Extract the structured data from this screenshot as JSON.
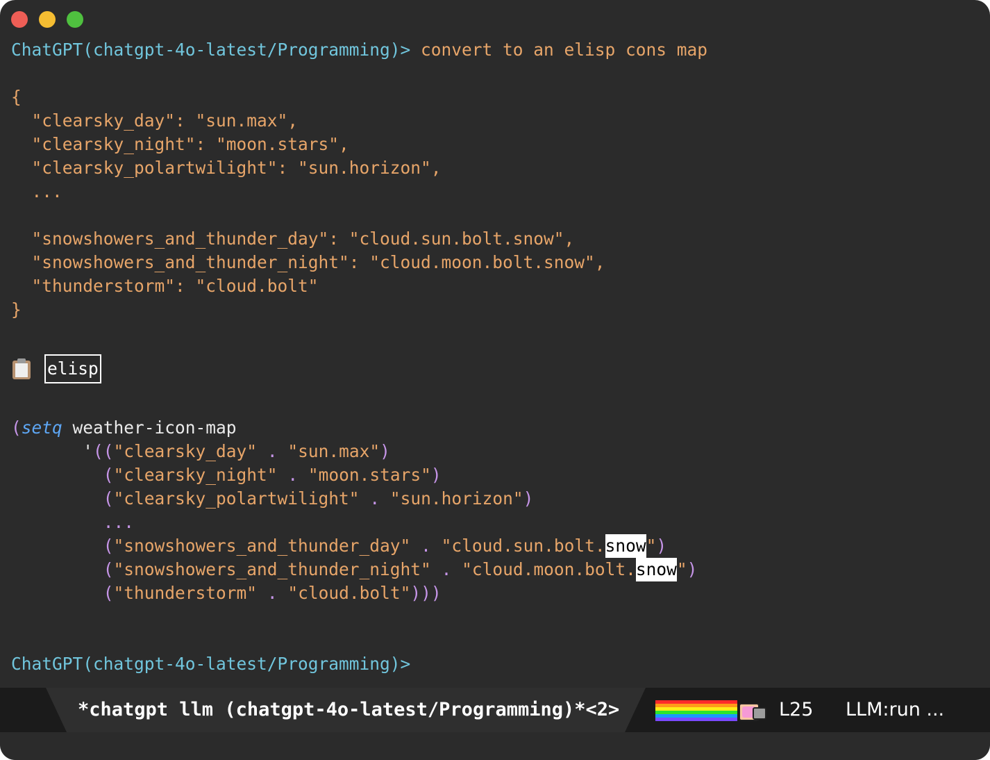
{
  "window": {
    "controls": [
      "close",
      "minimize",
      "maximize"
    ]
  },
  "session": {
    "prompt": "ChatGPT(chatgpt-4o-latest/Programming)>",
    "user_input": " convert to an elisp cons map",
    "final_prompt": "ChatGPT(chatgpt-4o-latest/Programming)>"
  },
  "json_block": {
    "open": "{",
    "lines": [
      "  \"clearsky_day\": \"sun.max\",",
      "  \"clearsky_night\": \"moon.stars\",",
      "  \"clearsky_polartwilight\": \"sun.horizon\",",
      "  ...",
      "",
      "  \"snowshowers_and_thunder_day\": \"cloud.sun.bolt.snow\",",
      "  \"snowshowers_and_thunder_night\": \"cloud.moon.bolt.snow\",",
      "  \"thunderstorm\": \"cloud.bolt\""
    ],
    "close": "}"
  },
  "code_block": {
    "language": "elisp",
    "setq": "setq",
    "var": " weather-icon-map",
    "quote": "'",
    "ellipsis": "...",
    "entries": [
      {
        "key": "\"clearsky_day\"",
        "val": "\"sun.max\""
      },
      {
        "key": "\"clearsky_night\"",
        "val": "\"moon.stars\""
      },
      {
        "key": "\"clearsky_polartwilight\"",
        "val": "\"sun.horizon\""
      },
      {
        "key": "\"snowshowers_and_thunder_day\"",
        "val_pre": "\"cloud.sun.bolt.",
        "val_hl": "snow",
        "val_post": "\""
      },
      {
        "key": "\"snowshowers_and_thunder_night\"",
        "val_pre": "\"cloud.moon.bolt.",
        "val_hl": "snow",
        "val_post": "\""
      },
      {
        "key": "\"thunderstorm\"",
        "val": "\"cloud.bolt\""
      }
    ]
  },
  "modeline": {
    "buffer_name": "*chatgpt llm (chatgpt-4o-latest/Programming)*<2>",
    "line_number": "L25",
    "mode_status": "LLM:run ..."
  },
  "colors": {
    "background": "#2b2b2b",
    "prompt": "#71c6dd",
    "text_orange": "#e7a569",
    "paren_purple": "#c695e8",
    "keyword_blue": "#5ea7f5",
    "modeline_bg": "#1b1b1b"
  }
}
